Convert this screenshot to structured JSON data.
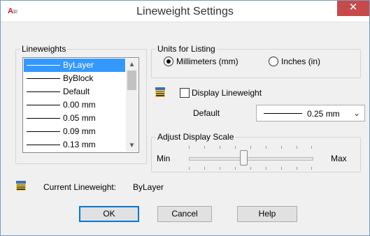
{
  "window": {
    "title": "Lineweight Settings",
    "app_icon_letter": "A",
    "app_icon_sub": "10",
    "close_glyph": "✕"
  },
  "lineweights": {
    "legend": "Lineweights",
    "items": [
      "ByLayer",
      "ByBlock",
      "Default",
      "0.00 mm",
      "0.05 mm",
      "0.09 mm",
      "0.13 mm"
    ],
    "selected": "ByLayer"
  },
  "units": {
    "legend": "Units for Listing",
    "millimeters_label": "Millimeters (mm)",
    "inches_label": "Inches (in)",
    "selected": "Millimeters (mm)"
  },
  "display_lineweight": {
    "label": "Display Lineweight",
    "checked": false
  },
  "default_lw": {
    "label": "Default",
    "value": "0.25 mm"
  },
  "scale": {
    "legend": "Adjust Display Scale",
    "min_label": "Min",
    "max_label": "Max",
    "position": 0.42
  },
  "current": {
    "label": "Current Lineweight:",
    "value": "ByLayer"
  },
  "buttons": {
    "ok": "OK",
    "cancel": "Cancel",
    "help": "Help"
  },
  "colors": {
    "selection": "#3399ff",
    "close_button": "#c74a4a",
    "default_button_border": "#0078d7"
  },
  "icons": [
    "autocad-app-icon",
    "lineweight-icon"
  ]
}
